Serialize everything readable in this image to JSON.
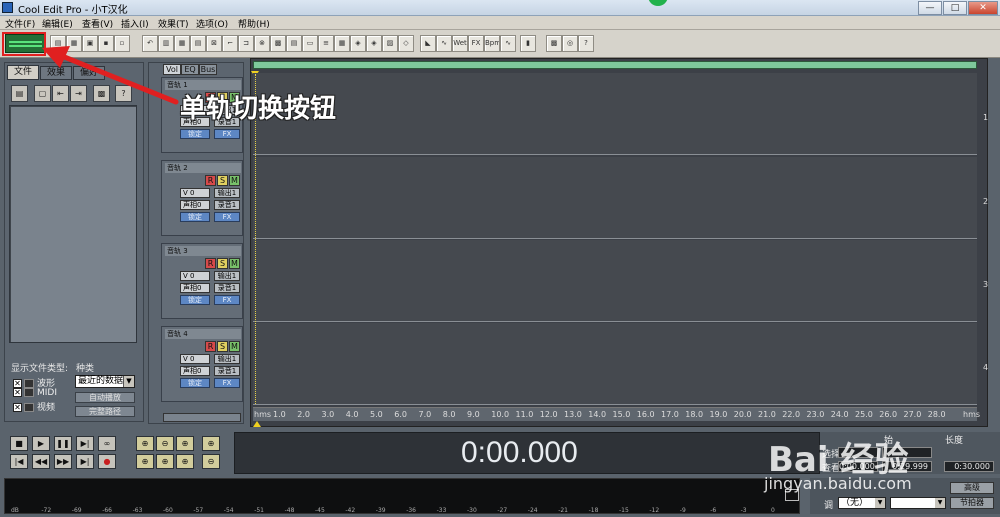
{
  "window": {
    "title": "Cool Edit Pro  - 小T汉化",
    "min": "—",
    "max": "□",
    "close": "✕"
  },
  "menu": [
    "文件(F)",
    "编辑(E)",
    "查看(V)",
    "插入(I)",
    "效果(T)",
    "选项(O)",
    "帮助(H)"
  ],
  "toolbar_icons": [
    "open-file",
    "open-folder",
    "save-session",
    "save",
    "save-as",
    "undo",
    "grid",
    "time",
    "mix",
    "marker",
    "envelope",
    "cut",
    "copy",
    "paste",
    "mixdown",
    "align",
    "loop",
    "punch",
    "insert",
    "fade",
    "wet",
    "fx",
    "bpm",
    "dc",
    "metronome",
    "eq",
    "cd",
    "help"
  ],
  "toolbar_glyphs": {
    "wet": "Wet",
    "fx": "FX",
    "bpm": "Bpm",
    "help": "?"
  },
  "left_panel": {
    "tabs": [
      "文件",
      "效果",
      "偏好"
    ],
    "list_icons": [
      "open",
      "close",
      "insert",
      "mixdown",
      "edit",
      "help"
    ],
    "show_types_label": "显示文件类型:",
    "types": [
      {
        "label": "波形",
        "checked": true
      },
      {
        "label": "MIDI",
        "checked": true
      },
      {
        "label": "视频",
        "checked": true
      }
    ],
    "sort_label": "种类",
    "sort_value": "最近的数据",
    "auto_play": "自动播放",
    "full_path": "完整路径"
  },
  "track_panel": {
    "tabs": [
      "Vol",
      "EQ",
      "Bus"
    ],
    "tracks": [
      {
        "name": "音轨 1",
        "vol": "V 0",
        "pan": "声相0",
        "out": "输出1",
        "rec": "录音1",
        "lock": "锁定",
        "fx": "FX",
        "r": "R",
        "s": "S",
        "m": "M"
      },
      {
        "name": "音轨 2",
        "vol": "V 0",
        "pan": "声相0",
        "out": "输出1",
        "rec": "录音1",
        "lock": "锁定",
        "fx": "FX",
        "r": "R",
        "s": "S",
        "m": "M"
      },
      {
        "name": "音轨 3",
        "vol": "V 0",
        "pan": "声相0",
        "out": "输出1",
        "rec": "录音1",
        "lock": "锁定",
        "fx": "FX",
        "r": "R",
        "s": "S",
        "m": "M"
      },
      {
        "name": "音轨 4",
        "vol": "V 0",
        "pan": "声相0",
        "out": "输出1",
        "rec": "录音1",
        "lock": "锁定",
        "fx": "FX",
        "r": "R",
        "s": "S",
        "m": "M"
      }
    ]
  },
  "timeline": {
    "lane_numbers": [
      "1",
      "2",
      "3",
      "4"
    ],
    "ruler_start": "hms",
    "ruler_end": "hms",
    "ticks": [
      "1.0",
      "2.0",
      "3.0",
      "4.0",
      "5.0",
      "6.0",
      "7.0",
      "8.0",
      "9.0",
      "10.0",
      "11.0",
      "12.0",
      "13.0",
      "14.0",
      "15.0",
      "16.0",
      "17.0",
      "18.0",
      "19.0",
      "20.0",
      "21.0",
      "22.0",
      "23.0",
      "24.0",
      "25.0",
      "26.0",
      "27.0",
      "28.0"
    ]
  },
  "transport": {
    "row1": [
      "■",
      "▶",
      "❚❚",
      "▶|",
      "∞"
    ],
    "row2": [
      "|◀",
      "◀◀",
      "▶▶",
      "▶|",
      "●"
    ]
  },
  "zoom": {
    "row1": [
      "⊕",
      "⊖",
      "⊕",
      "⊕"
    ],
    "row2": [
      "⊕",
      "⊕",
      "⊕",
      "⊖"
    ]
  },
  "time_display": "0:00.000",
  "selection": {
    "start_label": "始",
    "length_label": "长度",
    "sel_label": "选择",
    "view_label": "查看",
    "sel_start": "",
    "sel_end": "",
    "view_start": "0:00.000",
    "view_end": "0:29.999",
    "length": "0:30.000"
  },
  "level_ticks": [
    "dB",
    "-72",
    "-69",
    "-66",
    "-63",
    "-60",
    "-57",
    "-54",
    "-51",
    "-48",
    "-45",
    "-42",
    "-39",
    "-36",
    "-33",
    "-30",
    "-27",
    "-24",
    "-21",
    "-18",
    "-15",
    "-12",
    "-9",
    "-6",
    "-3",
    "0"
  ],
  "bottom_right": {
    "pitch_label": "调",
    "pitch_value": "（无）",
    "advanced": "高级",
    "metronome": "节拍器"
  },
  "annotation": "单轨切换按钮",
  "watermark": {
    "text": "Bai  经验",
    "url": "jingyan.baidu.com"
  },
  "colors": {
    "highlight": "#e02020",
    "accent_green": "#236f37",
    "overview": "#7ec99b"
  }
}
